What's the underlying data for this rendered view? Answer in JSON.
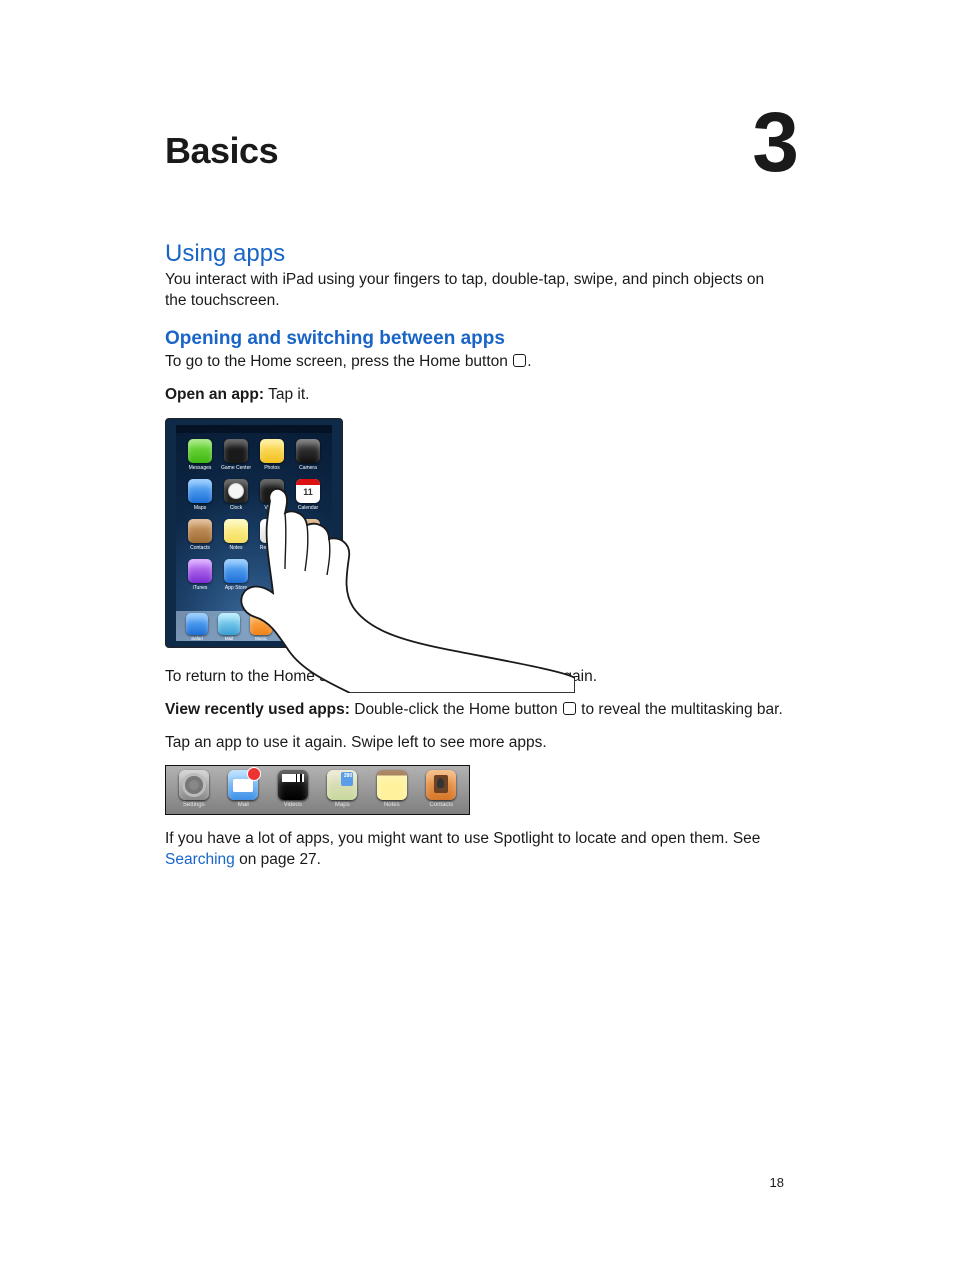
{
  "chapter": {
    "title": "Basics",
    "number": "3"
  },
  "section1": {
    "heading": "Using apps",
    "para": "You interact with iPad using your fingers to tap, double-tap, swipe, and pinch objects on the touchscreen."
  },
  "section2": {
    "heading": "Opening and switching between apps",
    "para1_a": "To go to the Home screen, press the Home button ",
    "para1_b": ".",
    "open_bold": "Open an app:",
    "open_rest": "  Tap it.",
    "para2_a": "To return to the Home screen, press the Home button ",
    "para2_b": " again.",
    "view_bold": "View recently used apps:",
    "view_rest_a": "  Double-click the Home button ",
    "view_rest_b": " to reveal the multitasking bar.",
    "para3": "Tap an app to use it again. Swipe left to see more apps.",
    "para4_a": "If you have a lot of apps, you might want to use Spotlight to locate and open them. See ",
    "para4_link": "Searching",
    "para4_b": " on page 27."
  },
  "ipad_apps": [
    {
      "label": "Messages",
      "c": "c-green"
    },
    {
      "label": "Game Center",
      "c": "c-dark"
    },
    {
      "label": "Photos",
      "c": "c-yellow"
    },
    {
      "label": "Camera",
      "c": "c-black"
    },
    {
      "label": "Maps",
      "c": "c-blue"
    },
    {
      "label": "Clock",
      "c": "c-clock"
    },
    {
      "label": "Videos",
      "c": "c-dark"
    },
    {
      "label": "Calendar",
      "c": "c-cal"
    },
    {
      "label": "Contacts",
      "c": "c-brown"
    },
    {
      "label": "Notes",
      "c": "c-note"
    },
    {
      "label": "Reminders",
      "c": "c-white"
    },
    {
      "label": "Newsstand",
      "c": "c-brown"
    },
    {
      "label": "iTunes",
      "c": "c-purple"
    },
    {
      "label": "App Store",
      "c": "c-blue"
    },
    {
      "label": "",
      "c": ""
    },
    {
      "label": "",
      "c": ""
    }
  ],
  "dock_apps": [
    {
      "label": "Safari",
      "c": "c-blue"
    },
    {
      "label": "Mail",
      "c": "c-cyan"
    },
    {
      "label": "Music",
      "c": "c-orange"
    }
  ],
  "multitask": [
    {
      "label": "Settings",
      "c": "mt-settings",
      "badge": false
    },
    {
      "label": "Mail",
      "c": "mt-mail",
      "badge": true
    },
    {
      "label": "Videos",
      "c": "mt-videos",
      "badge": false
    },
    {
      "label": "Maps",
      "c": "mt-maps",
      "badge": false
    },
    {
      "label": "Notes",
      "c": "mt-notes",
      "badge": false
    },
    {
      "label": "Contacts",
      "c": "mt-contacts",
      "badge": false
    }
  ],
  "page_number": "18"
}
